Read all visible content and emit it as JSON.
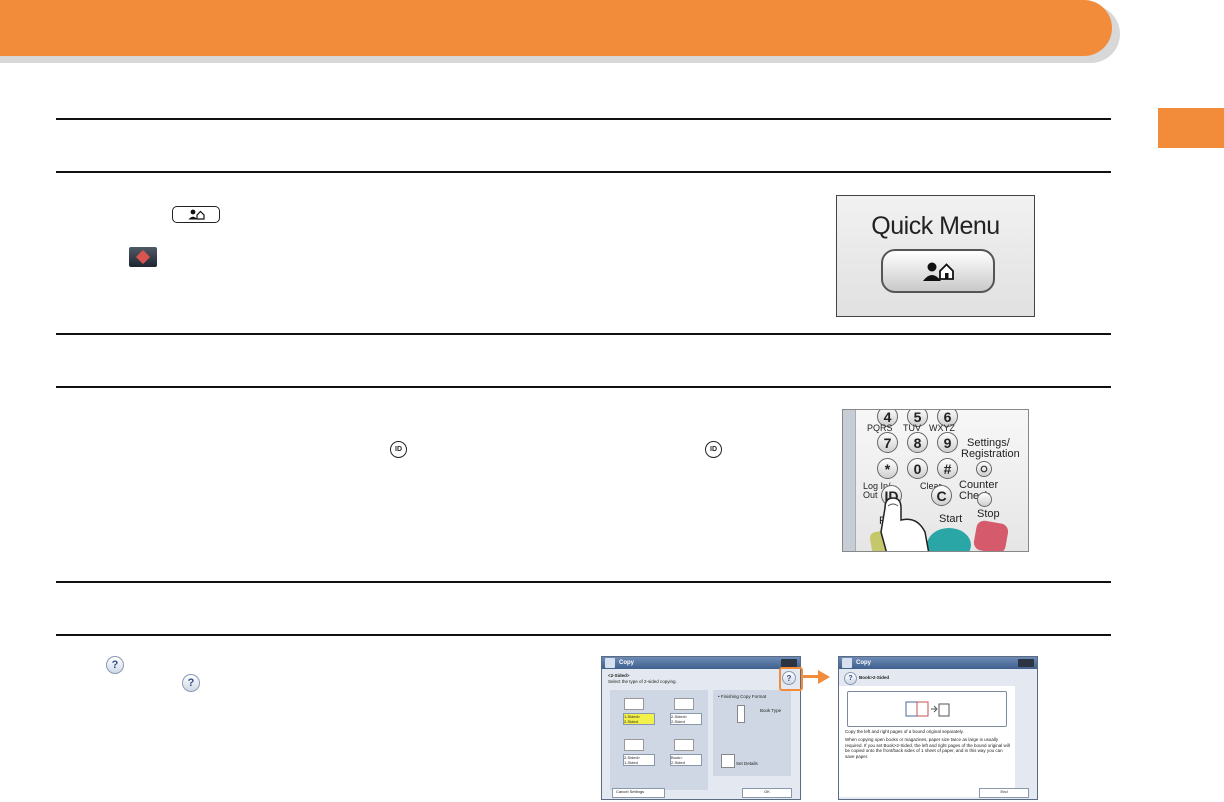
{
  "colors": {
    "accent": "#f28c3b",
    "rule": "#111111"
  },
  "quick_menu": {
    "title": "Quick Menu"
  },
  "keypad": {
    "keys": [
      "4",
      "5",
      "6",
      "7",
      "8",
      "9",
      "*",
      "0",
      "#",
      "ID",
      "C"
    ],
    "letters_pqrs": "PQRS",
    "letters_tuv": "TUV",
    "letters_wxyz": "WXYZ",
    "settings_label": "Settings/",
    "settings_label2": "Registration",
    "login_label": "Log In/",
    "login_label2": "Out",
    "clear_label": "Clear",
    "counter_label": "Counter Check",
    "stop_label": "Stop",
    "start_label": "Start",
    "reset_partial": "Re"
  },
  "inline_icons": {
    "id_key": "ID",
    "help": "?"
  },
  "screen1": {
    "title": "Copy",
    "heading": "<2-Sided>",
    "instruction": "Select the type of 2-sided copying.",
    "options": [
      "1-Sided>\n2-Sided",
      "2-Sided>\n2-Sided",
      "2-Sided>\n1-Sided",
      "Book>\n2-Sided"
    ],
    "finishing_label": "• Finishing Copy Format",
    "book_type": "Book Type",
    "set_details": "Set Details",
    "cancel": "Cancel Settings",
    "ok": "OK",
    "help": "?"
  },
  "screen2": {
    "title": "Copy",
    "heading": "Book>2-Sided",
    "line1": "Copy the left and right pages of a bound original separately.",
    "line2": "When copying open books or magazines, paper size twice as large is usually required. If you set Book>2-Sided, the left and right pages of the bound original will be copied onto the front/back sides of 1 sheet of paper, and in this way you can save paper.",
    "end": "End",
    "help": "?"
  }
}
